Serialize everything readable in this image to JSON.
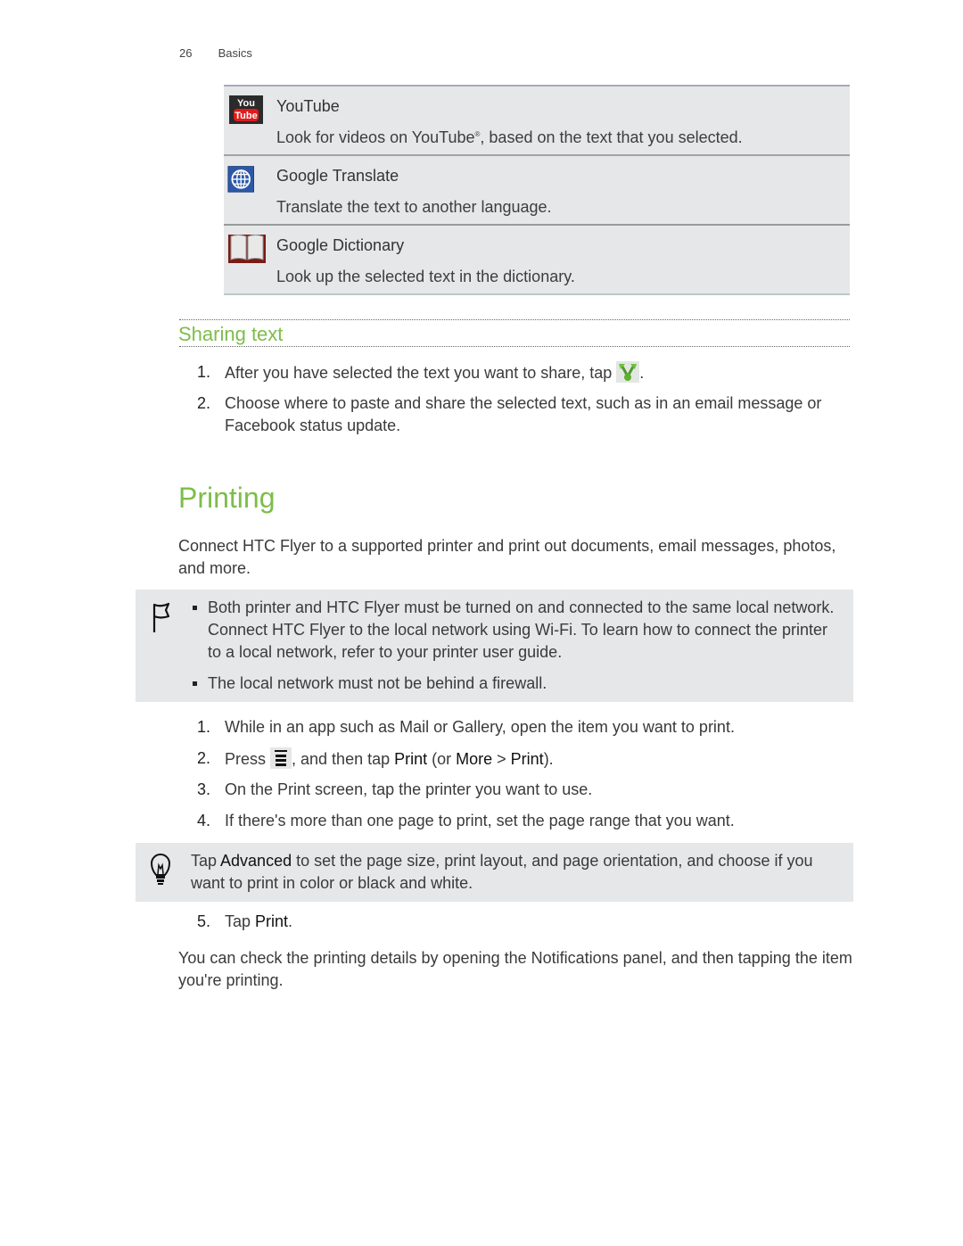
{
  "header": {
    "page_number": "26",
    "chapter": "Basics"
  },
  "menu_items": [
    {
      "icon": "youtube-icon",
      "title": "YouTube",
      "desc_before": "Look for videos on YouTube",
      "desc_sup": "®",
      "desc_after": ", based on the text that you selected."
    },
    {
      "icon": "globe-icon",
      "title": "Google Translate",
      "desc": "Translate the text to another language."
    },
    {
      "icon": "book-icon",
      "title": "Google Dictionary",
      "desc": "Look up the selected text in the dictionary."
    }
  ],
  "sharing": {
    "title": "Sharing text",
    "steps": [
      {
        "n": "1.",
        "text_before": "After you have selected the text you want to share, tap ",
        "icon": "share-icon",
        "text_after": "."
      },
      {
        "n": "2.",
        "text": "Choose where to paste and share the selected text, such as in an email message or Facebook status update."
      }
    ]
  },
  "printing": {
    "title": "Printing",
    "intro": "Connect HTC Flyer to a supported printer and print out documents, email messages, photos, and more.",
    "note": {
      "icon": "flag-icon",
      "bullets": [
        "Both printer and HTC Flyer must be turned on and connected to the same local network. Connect HTC Flyer to the local network using Wi-Fi. To learn how to connect the printer to a local network, refer to your printer user guide.",
        "The local network must not be behind a firewall."
      ]
    },
    "steps": [
      {
        "n": "1.",
        "text": "While in an app such as Mail or Gallery, open the item you want to print."
      },
      {
        "n": "2.",
        "p1": "Press ",
        "icon": "menu-icon",
        "p2": ", and then tap ",
        "b1": "Print",
        "p3": " (or ",
        "b2": "More",
        "p4": " > ",
        "b3": "Print",
        "p5": ")."
      },
      {
        "n": "3.",
        "text": "On the Print screen, tap the printer you want to use."
      },
      {
        "n": "4.",
        "text": "If there's more than one page to print, set the page range that you want."
      }
    ],
    "tip": {
      "icon": "lightbulb-icon",
      "p1": "Tap ",
      "b1": "Advanced",
      "p2": " to set the page size, print layout, and page orientation, and choose if you want to print in color or black and white."
    },
    "step5": {
      "n": "5.",
      "p1": "Tap ",
      "b1": "Print",
      "p2": "."
    },
    "outro": "You can check the printing details by opening the Notifications panel, and then tapping the item you're printing."
  }
}
